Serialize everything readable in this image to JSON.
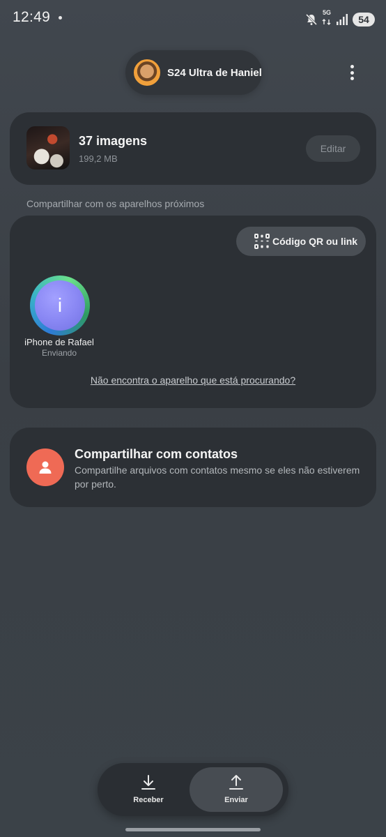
{
  "status_bar": {
    "time": "12:49",
    "network": "5G",
    "battery": "54"
  },
  "device": {
    "name": "S24 Ultra de Haniel"
  },
  "files": {
    "title": "37 imagens",
    "size": "199,2 MB",
    "edit_label": "Editar"
  },
  "nearby": {
    "section_label": "Compartilhar com os aparelhos próximos",
    "qr_label": "Código QR ou link",
    "peer": {
      "initial": "i",
      "name": "iPhone de Rafael",
      "status": "Enviando"
    },
    "help_link": "Não encontra o aparelho que está procurando?"
  },
  "contacts": {
    "title": "Compartilhar com contatos",
    "description": "Compartilhe arquivos com contatos mesmo se eles não estiverem por perto."
  },
  "bottom_nav": {
    "receive_label": "Receber",
    "send_label": "Enviar",
    "active": "Enviar"
  },
  "colors": {
    "background": "#3d4349",
    "card": "#2c3035",
    "contact_accent": "#ef6a55",
    "peer_accent": "#8a88f4"
  }
}
